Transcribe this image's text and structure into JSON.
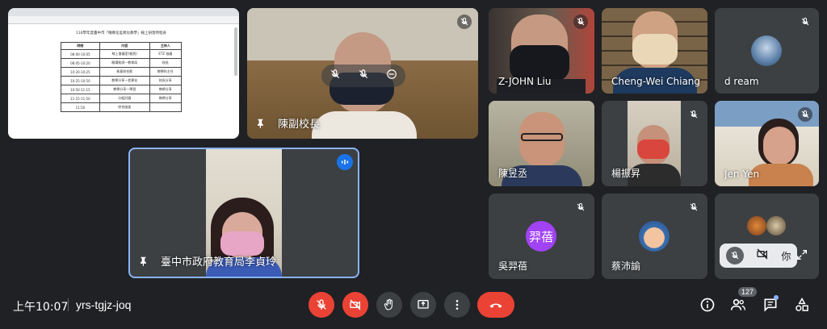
{
  "meeting": {
    "time": "上午10:07",
    "code": "yrs-tgjz-joq"
  },
  "participants_count": "127",
  "document": {
    "title": "110學年度臺中市「精緻化差異化教學」線上研習時程表",
    "rows": [
      [
        "08:00-10:05",
        "線上會議室(報到)",
        "ETZ 協議"
      ],
      [
        "08:05-10:20",
        "開場致詞—教育局",
        "校長"
      ],
      [
        "10:20-10:25",
        "致意與合影",
        "教學科主任"
      ],
      [
        "10:25-10:50",
        "教學分享—差異化",
        "校長分享"
      ],
      [
        "10:50-11:15",
        "教學分享—學習",
        "教師分享"
      ],
      [
        "11:15-11:50",
        "分組討論",
        "教師分享"
      ],
      [
        "11:50",
        "綜合座談",
        ""
      ]
    ],
    "headers": [
      "時間",
      "內容",
      "主持人"
    ]
  },
  "tiles": [
    {
      "name": "陳副校長"
    },
    {
      "name": "臺中市政府教育局李貞玲"
    },
    {
      "name": "Z-JOHN Liu"
    },
    {
      "name": "Cheng-Wei Chiang"
    },
    {
      "name": "d ream"
    },
    {
      "name": "陳昱丞"
    },
    {
      "name": "楊振昇"
    },
    {
      "name": "Jen Yen"
    },
    {
      "name": "吳羿蓓",
      "initials": "羿蓓"
    },
    {
      "name": "蔡沛諭"
    }
  ],
  "overflow_tile": {
    "label": "你"
  },
  "colors": {
    "accent": "#8ab4f8",
    "danger": "#ea4335",
    "avatar_purple": "#a142f4"
  }
}
